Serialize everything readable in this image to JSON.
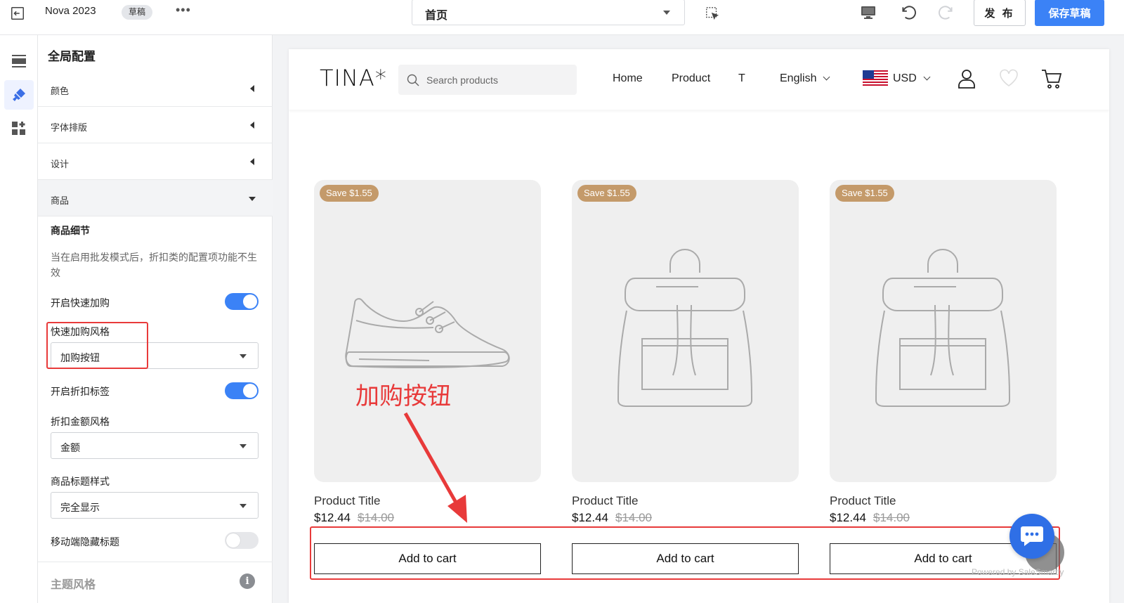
{
  "topbar": {
    "store_name": "Nova 2023",
    "badge": "草稿",
    "more": "•••",
    "page_selector": "首页",
    "publish_label": "发 布",
    "save_label": "保存草稿"
  },
  "panel": {
    "title": "全局配置",
    "sections": [
      {
        "label": "颜色"
      },
      {
        "label": "字体排版"
      },
      {
        "label": "设计"
      },
      {
        "label": "商品"
      }
    ],
    "product_detail_title": "商品细节",
    "product_detail_desc": "当在启用批发模式后，折扣类的配置项功能不生效",
    "quick_add_label": "开启快速加购",
    "quick_add_style_label": "快速加购风格",
    "quick_add_style_value": "加购按钮",
    "discount_tag_label": "开启折扣标签",
    "discount_style_label": "折扣金额风格",
    "discount_style_value": "金额",
    "title_style_label": "商品标题样式",
    "title_style_value": "完全显示",
    "mobile_hide_title_label": "移动端隐藏标题",
    "theme_style_title": "主题风格",
    "info_glyph": "i"
  },
  "store": {
    "logo": "TINA*",
    "search_placeholder": "Search products",
    "nav": [
      "Home",
      "Product",
      "T"
    ],
    "language": "English",
    "currency": "USD",
    "products": [
      {
        "badge": "Save $1.55",
        "title": "Product Title",
        "price": "$12.44",
        "old_price": "$14.00",
        "button": "Add to cart"
      },
      {
        "badge": "Save $1.55",
        "title": "Product Title",
        "price": "$12.44",
        "old_price": "$14.00",
        "button": "Add to cart"
      },
      {
        "badge": "Save $1.55",
        "title": "Product Title",
        "price": "$12.44",
        "old_price": "$14.00",
        "button": "Add to cart"
      }
    ],
    "annotation": "加购按钮",
    "powered_by": "Powered by SaleSmartly"
  },
  "colors": {
    "accent": "#3b82f6",
    "annotation_red": "#e83a3a",
    "save_badge": "#c49a6a",
    "chat": "#2f6fe6"
  }
}
